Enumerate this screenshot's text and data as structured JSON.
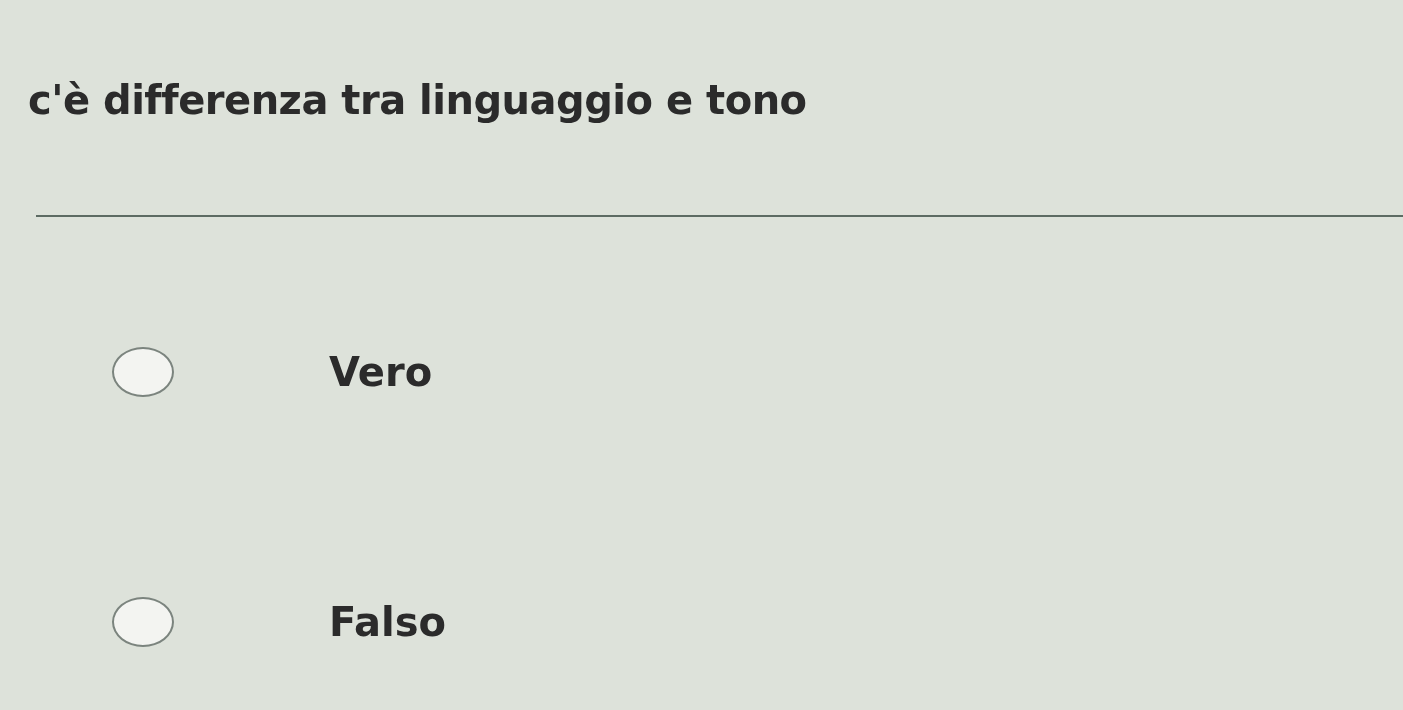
{
  "question": "c'è differenza tra linguaggio e tono",
  "options": [
    {
      "label": "Vero",
      "selected": false
    },
    {
      "label": "Falso",
      "selected": false
    }
  ]
}
